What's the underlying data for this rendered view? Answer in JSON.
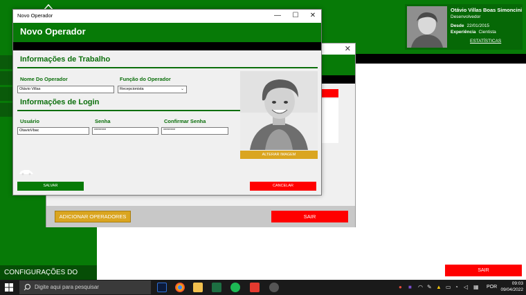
{
  "app": {
    "sidebar_footer_label": "CONFIGURAÇÕES DO SISTEMA",
    "sair_label": "SAIR",
    "profile": {
      "name": "Otávio Villas Boas Simoncini",
      "role": "Desenvolvedor",
      "since_label": "Desde",
      "since_value": "22/01/2015",
      "experience_label": "Experiência",
      "experience_value": "Cientista",
      "stats_link": "ESTATÍSTICAS"
    }
  },
  "operators_window": {
    "add_button": "ADICIONAR OPERADORES",
    "sair_button": "SAIR"
  },
  "new_operator_window": {
    "title": "Novo Operador",
    "heading": "Novo Operador",
    "work_section": {
      "title": "Informações de Trabalho",
      "name_label": "Nome Do Operador",
      "name_value": "Otávio Villas",
      "function_label": "Função do Operador",
      "function_value": "Recepcionista"
    },
    "login_section": {
      "title": "Informações de Login",
      "user_label": "Usuário",
      "user_value": "OtavioVbac",
      "password_label": "Senha",
      "password_value": "********",
      "confirm_label": "Confirmar Senha",
      "confirm_value": "********"
    },
    "change_image_button": "ALTERAR IMAGEM",
    "save_button": "SALVAR",
    "cancel_button": "CANCELAR"
  },
  "taskbar": {
    "search_placeholder": "Digite aqui para pesquisar",
    "language": "POR",
    "time": "09:03",
    "date": "09/04/2022"
  },
  "colors": {
    "primary_green": "#077a07",
    "danger_red": "#ff0000",
    "accent_gold": "#daa520"
  }
}
